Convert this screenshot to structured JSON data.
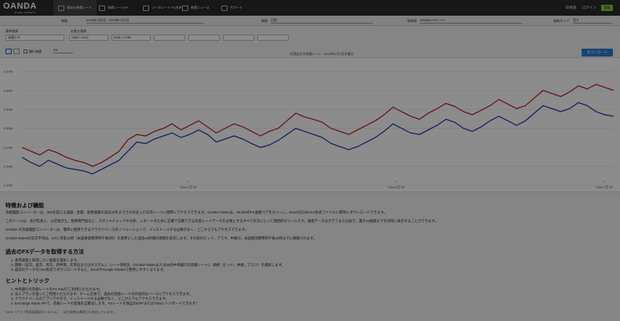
{
  "header": {
    "logo_text": "OANDA",
    "logo_sub": "GLOBAL MARKETS",
    "nav": [
      {
        "label": "過去の為替レート",
        "active": true
      },
      {
        "label": "為替レートAPI"
      },
      {
        "label": "コーポレート FX決済"
      },
      {
        "label": "為替ニュース"
      },
      {
        "label": "サポート"
      }
    ],
    "lang": "日本語",
    "login": "ログイン",
    "register": "登録"
  },
  "filters": {
    "period_label": "期間",
    "period_value": "2016年1月3日 - 2016年7月3日",
    "freq_label": "間隔",
    "freq_value": "日別",
    "source_label": "情報源",
    "source_value": "OANDA FXレート",
    "price_label": "価格タイプ",
    "price_value": "売り"
  },
  "currency": {
    "base_label": "基準通貨",
    "quote_label": "必要な通貨",
    "base_placeholder": "米国ドル",
    "items": [
      {
        "code": "CAD",
        "value": "1.3437",
        "color": "#1c3b9c"
      },
      {
        "code": "AUD",
        "value": "1.3750",
        "color": "#c1272d"
      }
    ]
  },
  "chart_controls": {
    "band_label": "銀行為替",
    "pct_value": "5%",
    "download": "ダウンロード"
  },
  "chart_data": {
    "type": "line",
    "title": "対過去日の為替レート - 2016年1月3日木曜日",
    "ylim": [
      1.25,
      1.375
    ],
    "yticks": [
      "1.3750",
      "1.3500",
      "1.3250",
      "1.3000",
      "1.2750",
      "1.2500",
      "1.2250"
    ],
    "xticks": [
      "2016 3月 01",
      "2016 5月 01",
      "2016 7月 01"
    ],
    "series": [
      {
        "color": "#c1272d",
        "values": [
          1.275,
          1.27,
          1.265,
          1.272,
          1.268,
          1.262,
          1.258,
          1.255,
          1.25,
          1.255,
          1.262,
          1.27,
          1.285,
          1.292,
          1.29,
          1.296,
          1.3,
          1.306,
          1.298,
          1.304,
          1.31,
          1.302,
          1.294,
          1.3,
          1.306,
          1.302,
          1.296,
          1.29,
          1.296,
          1.3,
          1.31,
          1.32,
          1.315,
          1.312,
          1.308,
          1.3,
          1.296,
          1.292,
          1.298,
          1.304,
          1.31,
          1.318,
          1.328,
          1.322,
          1.316,
          1.312,
          1.32,
          1.326,
          1.333,
          1.329,
          1.322,
          1.318,
          1.324,
          1.33,
          1.338,
          1.332,
          1.326,
          1.33,
          1.34,
          1.35,
          1.346,
          1.342,
          1.348,
          1.356,
          1.352,
          1.358,
          1.354,
          1.35
        ]
      },
      {
        "color": "#3838b0",
        "values": [
          1.262,
          1.255,
          1.25,
          1.258,
          1.253,
          1.248,
          1.246,
          1.244,
          1.24,
          1.246,
          1.252,
          1.258,
          1.27,
          1.282,
          1.28,
          1.286,
          1.29,
          1.294,
          1.288,
          1.292,
          1.298,
          1.292,
          1.282,
          1.286,
          1.29,
          1.286,
          1.28,
          1.275,
          1.278,
          1.284,
          1.292,
          1.3,
          1.296,
          1.292,
          1.288,
          1.28,
          1.276,
          1.272,
          1.276,
          1.282,
          1.288,
          1.296,
          1.306,
          1.3,
          1.294,
          1.292,
          1.298,
          1.304,
          1.312,
          1.308,
          1.3,
          1.296,
          1.302,
          1.31,
          1.316,
          1.31,
          1.304,
          1.31,
          1.32,
          1.33,
          1.326,
          1.322,
          1.326,
          1.334,
          1.33,
          1.322,
          1.318,
          1.316
        ]
      }
    ]
  },
  "content": {
    "h1": "特徴および機能",
    "p1": "為替履歴コンバーターは、200を超える通貨、金属、仮想通貨の過去25年までさかのぼった日次レートに簡単にアクセスできます。OANDA Ratesは、38,000のFX通貨ペアをカバーし、Excel対応のCSV形式ファイルに簡単にダウンロードできます。",
    "p2": "このツールは、会計監査人、公認会計士、税務専門家など、スポットチェックや分析、レポートのために正確で信頼できる為替レートデータを必要とするすべての方にとって理想的なツールです。通貨データはグラフまたは表で、最大10通貨までを同時に表示することができます。",
    "p3": "OANDA の為替履歴コンバーターは、簡単に使用できるクラウドベースのソリューションで、インストールする必要がなく、どこからでもアクセスできます。",
    "p4": "OANDA Ratesの日次平均は、UTC 深夜12時（米国東部標準時午後8時）を基準とした過去24時間の期間を表示します。その日のビッド、アスク、中値が、米国東部標準時午後10時までに掲載されます。",
    "h2": "過去のFXデータを取得する方法",
    "steps": [
      "1. 基準通貨と取得したい通貨を選択します。",
      "2. 期間（日次、週次、月次、四半期、年単位またはカスタム）、レート参照先（OANDA Ratesまたは25の中央銀行の為替レート）、価格（ビッド、仲値、アスク）を選択します。",
      "3. 過去のデータをCSV形式でダウンロードすると、ExcelやGoogle Sheetsで使用しやすくなります。"
    ],
    "h3": "ヒントとトリック",
    "tips": [
      "1. 中央銀行の為替レートをFX Paidでご利用いただけます。",
      "2. 法人プランを使ってご利用いただけます。チーム全体で、過去の為替レートの代表的なソースにアクセスできます。",
      "3. クラウドベースのアプリですので、インストールする必要がなく、どこからでもアクセスできます。",
      "4. Exchange Rates APIで、為替レートの変換を自動化します。FXレートを独自のERPまたはTMSにインポートできます！"
    ],
    "note": "*AED（アラブ首長国連邦ディルハム）、ほか多数の通貨にも対応しています。"
  }
}
